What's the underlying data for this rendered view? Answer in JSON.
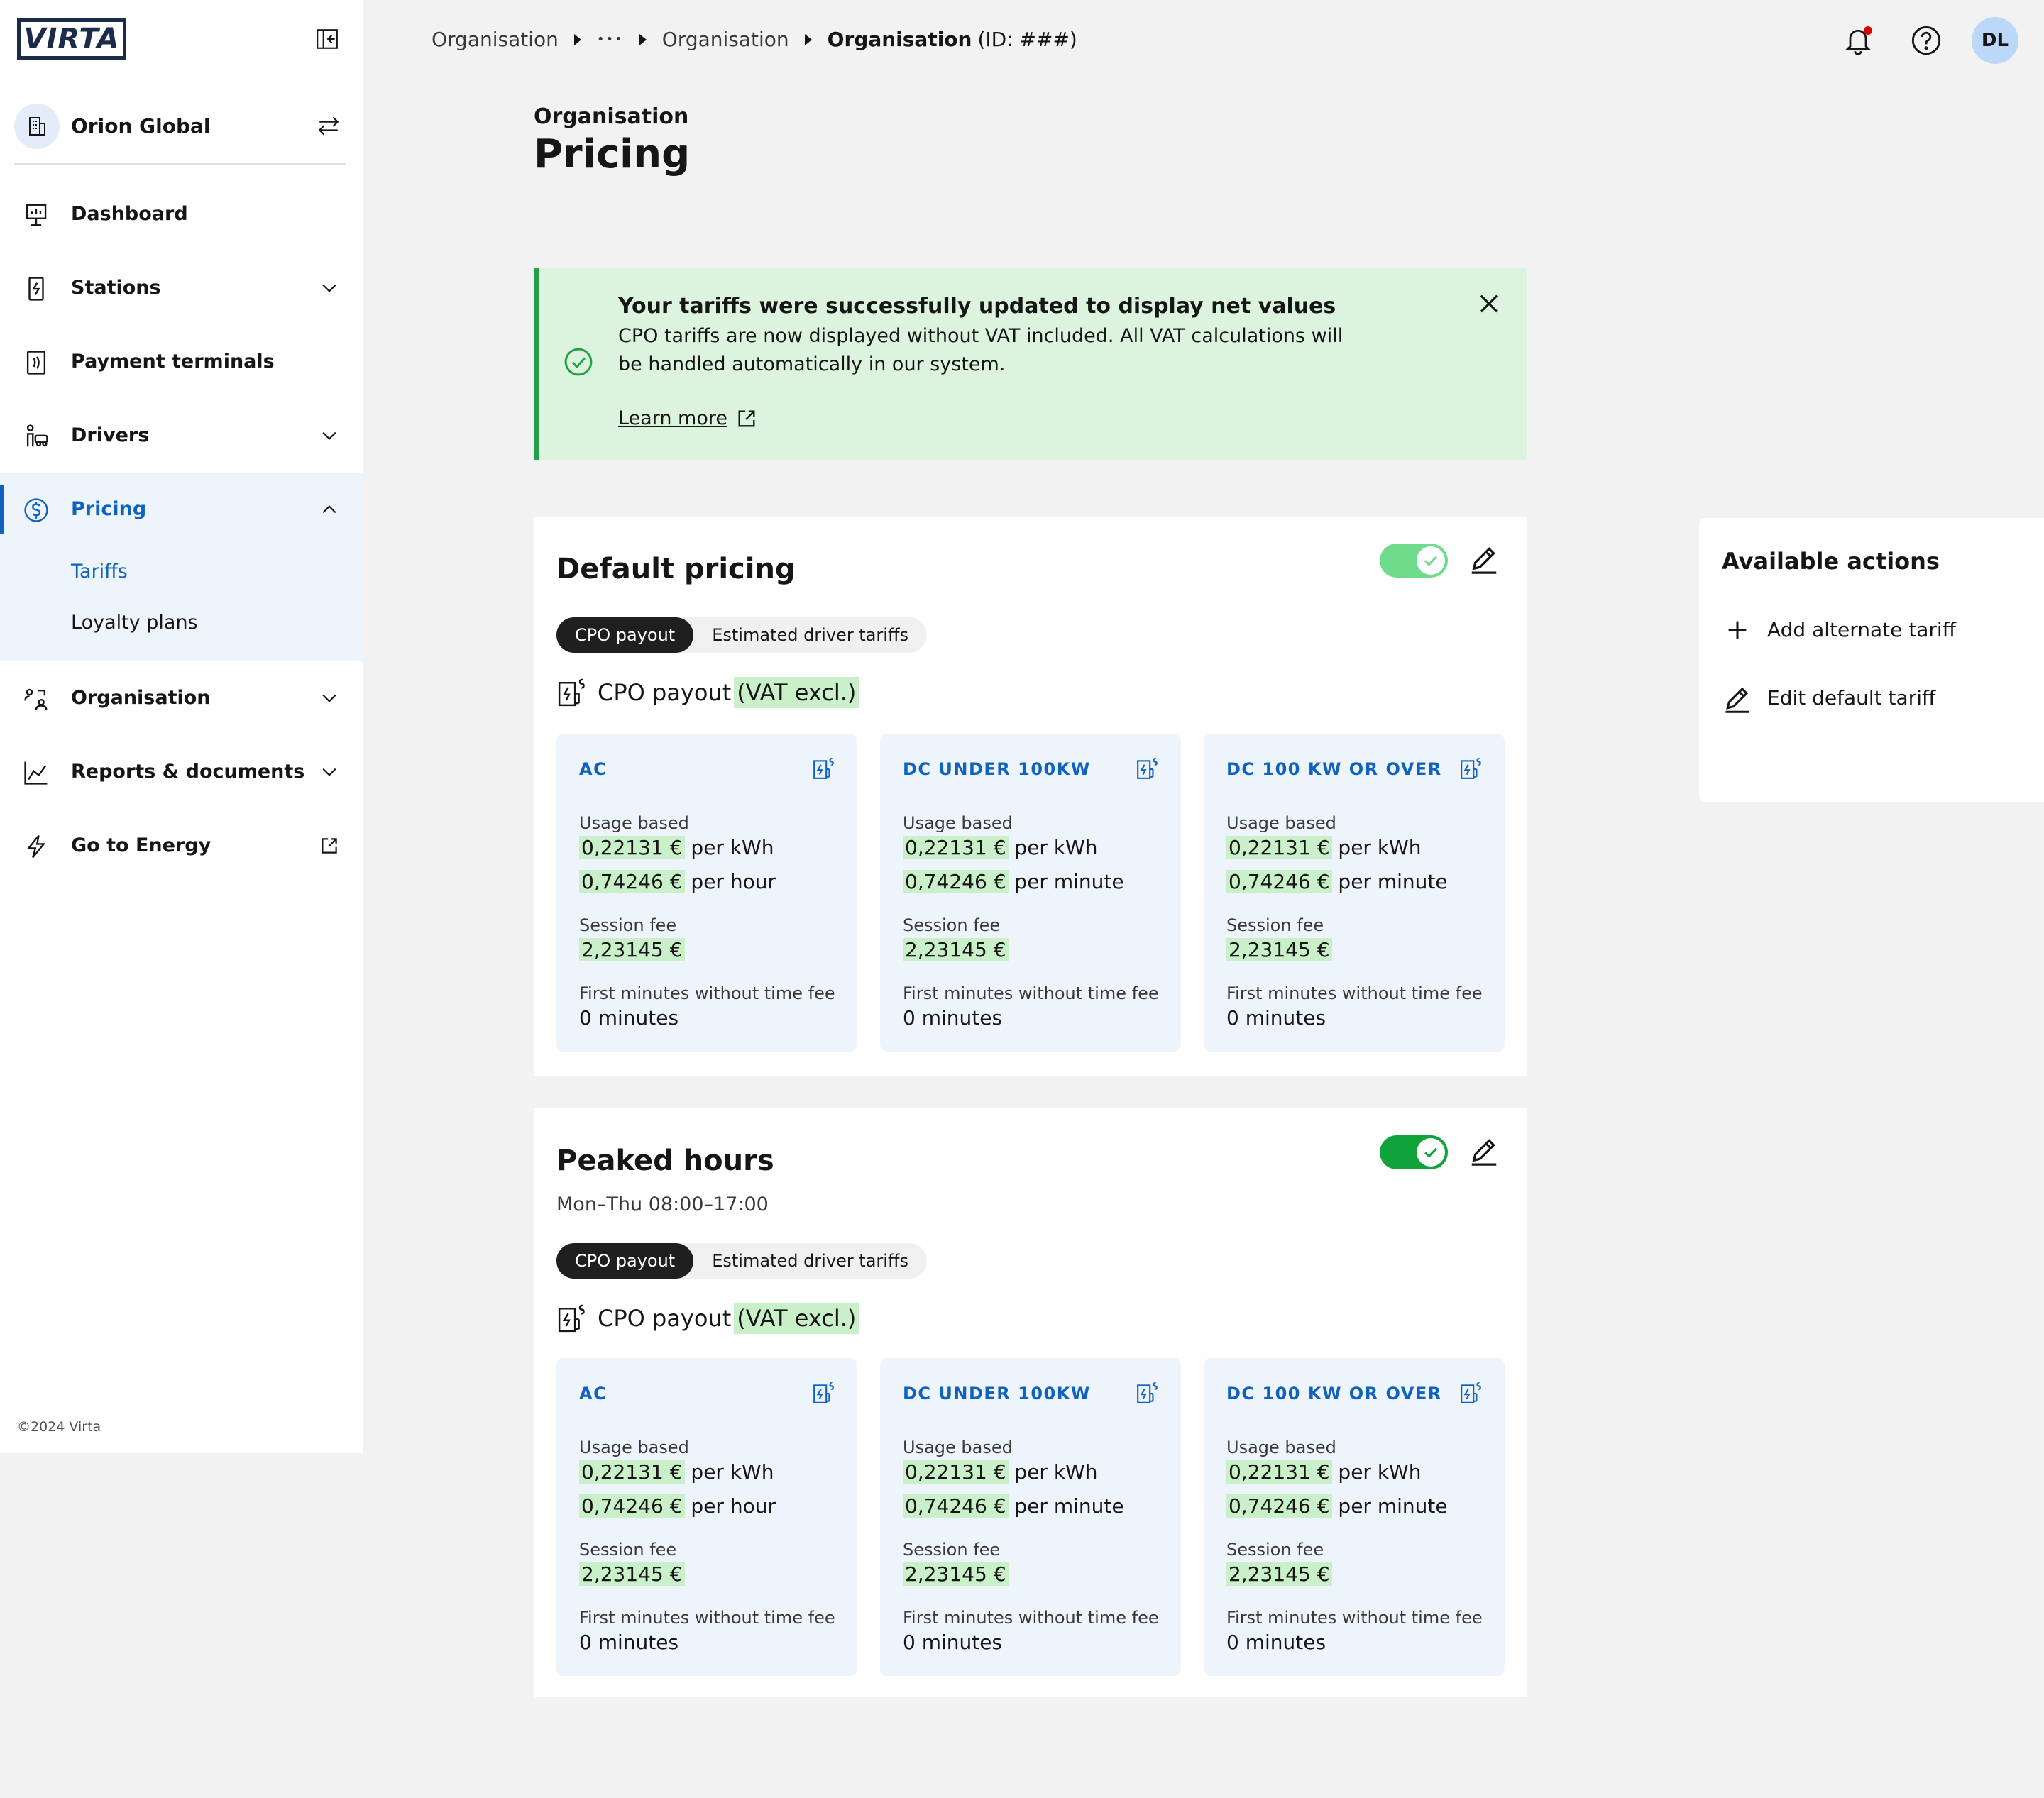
{
  "app": {
    "logo_text": "VIRTA",
    "copyright": "©2024 Virta"
  },
  "org": {
    "name": "Orion Global"
  },
  "nav": {
    "dashboard": "Dashboard",
    "stations": "Stations",
    "payment_terminals": "Payment terminals",
    "drivers": "Drivers",
    "pricing": "Pricing",
    "tariffs": "Tariffs",
    "loyalty_plans": "Loyalty plans",
    "organisation": "Organisation",
    "reports": "Reports & documents",
    "go_to_energy": "Go to Energy"
  },
  "breadcrumb": {
    "item1": "Organisation",
    "ellipsis": "•••",
    "item2": "Organisation",
    "current": "Organisation",
    "current_id": "(ID: ###)"
  },
  "user": {
    "initials": "DL"
  },
  "page": {
    "eyebrow": "Organisation",
    "title": "Pricing"
  },
  "banner": {
    "title": "Your tariffs were successfully updated to display net values",
    "text": "CPO tariffs are now displayed without VAT included. All VAT calculations will be handled automatically in our system.",
    "link": "Learn more"
  },
  "cards": [
    {
      "title": "Default pricing",
      "subtitle": "",
      "toggle_on": true,
      "seg_active": "CPO payout",
      "seg_other": "Estimated driver tariffs",
      "section_label": "CPO payout",
      "section_badge": "(VAT excl.)",
      "tiles": [
        {
          "head": "AC",
          "usage_label": "Usage based",
          "kwh_value": "0,22131 €",
          "kwh_unit": "per kWh",
          "time_value": "0,74246 €",
          "time_unit": "per hour",
          "fee_label": "Session fee",
          "fee_value": "2,23145 €",
          "free_label": "First minutes without time fee",
          "free_value": "0 minutes"
        },
        {
          "head": "DC UNDER 100KW",
          "usage_label": "Usage based",
          "kwh_value": "0,22131 €",
          "kwh_unit": "per kWh",
          "time_value": "0,74246 €",
          "time_unit": "per minute",
          "fee_label": "Session fee",
          "fee_value": "2,23145 €",
          "free_label": "First minutes without time fee",
          "free_value": "0 minutes"
        },
        {
          "head": "DC 100 KW OR OVER",
          "usage_label": "Usage based",
          "kwh_value": "0,22131 €",
          "kwh_unit": "per kWh",
          "time_value": "0,74246 €",
          "time_unit": "per minute",
          "fee_label": "Session fee",
          "fee_value": "2,23145 €",
          "free_label": "First minutes without time fee",
          "free_value": "0 minutes"
        }
      ]
    },
    {
      "title": "Peaked hours",
      "subtitle": "Mon–Thu 08:00–17:00",
      "toggle_on": true,
      "seg_active": "CPO payout",
      "seg_other": "Estimated driver tariffs",
      "section_label": "CPO payout",
      "section_badge": "(VAT excl.)",
      "tiles": [
        {
          "head": "AC",
          "usage_label": "Usage based",
          "kwh_value": "0,22131 €",
          "kwh_unit": "per kWh",
          "time_value": "0,74246 €",
          "time_unit": "per hour",
          "fee_label": "Session fee",
          "fee_value": "2,23145 €",
          "free_label": "First minutes without time fee",
          "free_value": "0 minutes"
        },
        {
          "head": "DC UNDER 100KW",
          "usage_label": "Usage based",
          "kwh_value": "0,22131 €",
          "kwh_unit": "per kWh",
          "time_value": "0,74246 €",
          "time_unit": "per minute",
          "fee_label": "Session fee",
          "fee_value": "2,23145 €",
          "free_label": "First minutes without time fee",
          "free_value": "0 minutes"
        },
        {
          "head": "DC 100 KW OR OVER",
          "usage_label": "Usage based",
          "kwh_value": "0,22131 €",
          "kwh_unit": "per kWh",
          "time_value": "0,74246 €",
          "time_unit": "per minute",
          "fee_label": "Session fee",
          "fee_value": "2,23145 €",
          "free_label": "First minutes without time fee",
          "free_value": "0 minutes"
        }
      ]
    }
  ],
  "actions": {
    "title": "Available actions",
    "add_alternate": "Add alternate tariff",
    "edit_default": "Edit default tariff"
  },
  "colors": {
    "accent": "#0f62c0",
    "success": "#24a148",
    "toggle_on_light": "#6fdc8c",
    "toggle_on": "#0fa33a",
    "highlight": "#c9f0c9"
  },
  "icons": {
    "collapse": "sidebar-collapse-icon",
    "switch": "switch-arrows-icon",
    "bell": "bell-icon",
    "help": "help-icon",
    "check": "check-circle-icon",
    "close": "close-icon",
    "external": "external-link-icon",
    "edit": "pencil-icon",
    "plus": "plus-icon",
    "tariff": "tariff-icon"
  }
}
